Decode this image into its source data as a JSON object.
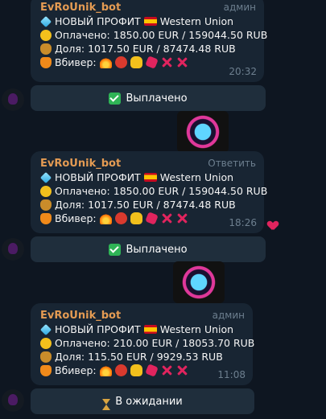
{
  "messages": [
    {
      "sender": "EvRoUnik_bot",
      "tag": "админ",
      "profit": "НОВЫЙ ПРОФИТ",
      "method": "Western Union",
      "paid": "Оплачено: 1850.00 EUR / 159044.50 RUB",
      "share": "Доля: 1017.50 EUR / 87474.48 RUB",
      "vbiver": "Вбивер:",
      "time": "20:32",
      "button": "Выплачено"
    },
    {
      "sender": "EvRoUnik_bot",
      "tag": "Ответить",
      "profit": "НОВЫЙ ПРОФИТ",
      "method": "Western Union",
      "paid": "Оплачено: 1850.00 EUR / 159044.50 RUB",
      "share": "Доля: 1017.50 EUR / 87474.48 RUB",
      "vbiver": "Вбивер:",
      "time": "18:26",
      "button": "Выплачено"
    },
    {
      "sender": "EvRoUnik_bot",
      "tag": "админ",
      "profit": "НОВЫЙ ПРОФИТ",
      "method": "Western Union",
      "paid": "Оплачено: 210.00 EUR / 18053.70 RUB",
      "share": "Доля: 115.50 EUR / 9929.53 RUB",
      "vbiver": "Вбивер:",
      "time": "11:08",
      "button": "В ожидании"
    }
  ],
  "icons": {
    "profit": "diamond-icon",
    "flag": "spain-flag-icon",
    "paid": "money-mouth-face-icon",
    "share": "money-bag-icon",
    "vbiver": "fox-icon",
    "reaction": "red-heart-icon",
    "status_paid": "check-mark-button-icon",
    "status_waiting": "hourglass-icon"
  },
  "colors": {
    "background": "#0e1621",
    "bubble": "#182533",
    "sender": "#e49b53",
    "button": "#1f2e3c"
  }
}
